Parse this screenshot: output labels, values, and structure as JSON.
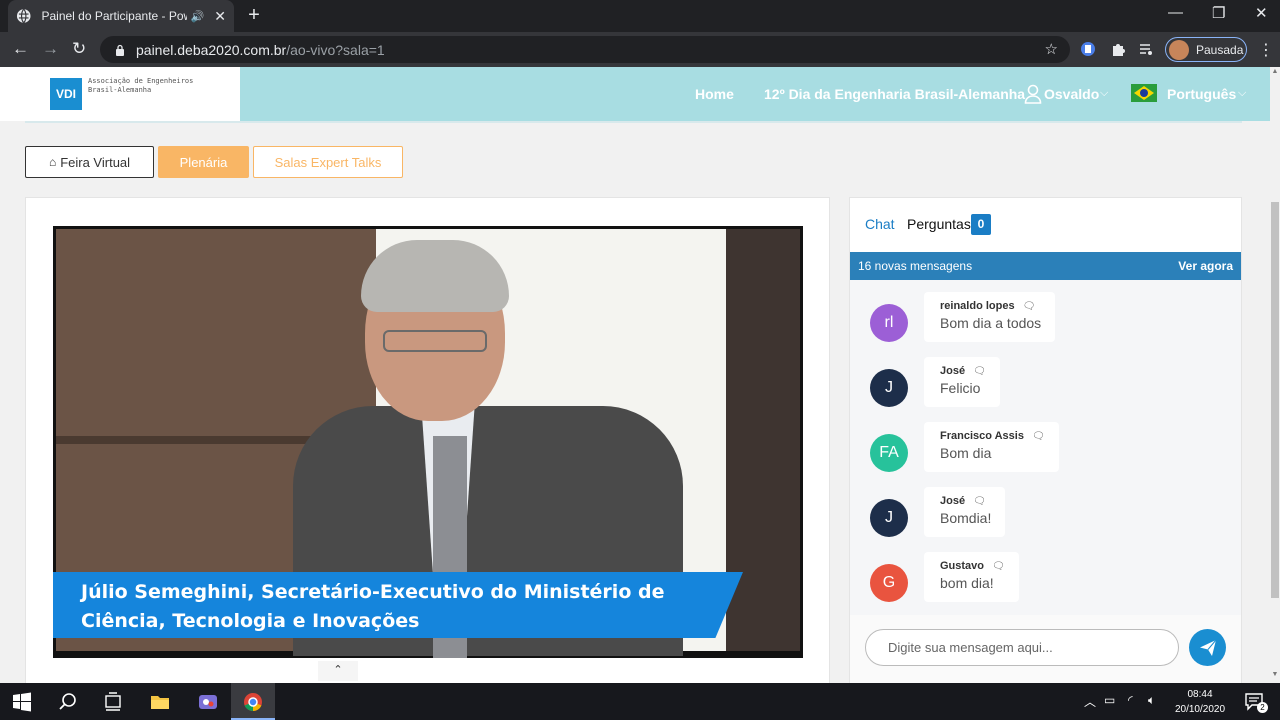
{
  "browser": {
    "tab_title": "Painel do Participante - Power",
    "url_host": "painel.deba2020.com.br",
    "url_path": "/ao-vivo?sala=1",
    "profile_label": "Pausada"
  },
  "site": {
    "logo_mark": "VDI",
    "logo_text": "Associação de Engenheiros\nBrasil-Alemanha",
    "nav": {
      "home": "Home",
      "event": "12º Dia da Engenharia Brasil-Alemanha",
      "user": "Osvaldo",
      "language": "Português"
    }
  },
  "tabs": {
    "feira": "Feira Virtual",
    "plenaria": "Plenária",
    "salas": "Salas Expert Talks"
  },
  "video": {
    "caption": "Júlio Semeghini, Secretário-Executivo do Ministério de Ciência, Tecnologia e Inovações"
  },
  "chat": {
    "tab_chat": "Chat",
    "tab_questions": "Perguntas",
    "questions_count": "0",
    "new_messages": "16 novas mensagens",
    "see_now": "Ver agora",
    "input_placeholder": "Digite sua mensagem aqui...",
    "messages": [
      {
        "initials": "rl",
        "name": "reinaldo lopes",
        "text": "Bom dia a todos",
        "color": "#9c5fd6"
      },
      {
        "initials": "J",
        "name": "José",
        "text": "Felicio",
        "color": "#1d2e4a"
      },
      {
        "initials": "FA",
        "name": "Francisco Assis",
        "text": "Bom dia",
        "color": "#27c29b"
      },
      {
        "initials": "J",
        "name": "José",
        "text": "Bomdia!",
        "color": "#1d2e4a"
      },
      {
        "initials": "G",
        "name": "Gustavo",
        "text": "bom dia!",
        "color": "#e9543f"
      }
    ]
  },
  "taskbar": {
    "time": "08:44",
    "date": "20/10/2020",
    "notifications": "2"
  },
  "colors": {
    "accent": "#f9b665",
    "header_bg": "#a8dde2",
    "chat_blue": "#1a7dc5"
  }
}
